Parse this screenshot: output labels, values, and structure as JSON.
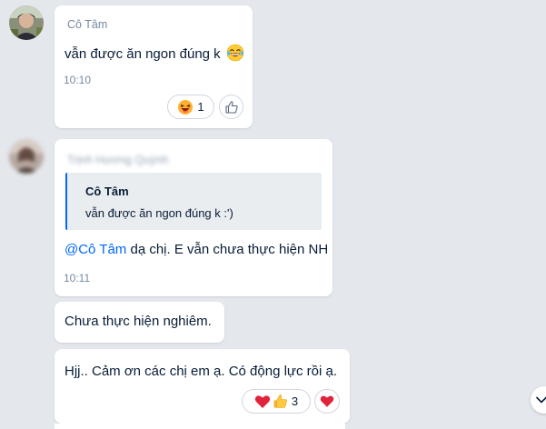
{
  "messages": [
    {
      "sender": "Cô Tâm",
      "text": "vẫn được ăn ngon đúng k",
      "emoji": "laughing-tears-emoji",
      "time": "10:10",
      "reaction": {
        "emoji": "haha-face-icon",
        "count": "1"
      }
    },
    {
      "sender": "Trịnh Hương Quỳnh",
      "quote": {
        "author": "Cô Tâm",
        "text": "vẫn được ăn ngon đúng k :')"
      },
      "mention": "@Cô Tâm",
      "text": " dạ chị.  E vẫn chưa thực hiện NH",
      "time": "10:11"
    },
    {
      "text": "Chưa thực hiện nghiêm."
    },
    {
      "text": "Hjj.. Cảm ơn các chị em ạ.  Có động lực rồi ạ.",
      "reaction": {
        "emojis": [
          "heart-icon",
          "thumbs-up-icon"
        ],
        "count": "3"
      }
    }
  ],
  "colors": {
    "background": "#e4e7ec",
    "bubble": "#ffffff",
    "accent": "#0068ff",
    "meta_text": "#7589a3",
    "heart": "#e0243a"
  }
}
